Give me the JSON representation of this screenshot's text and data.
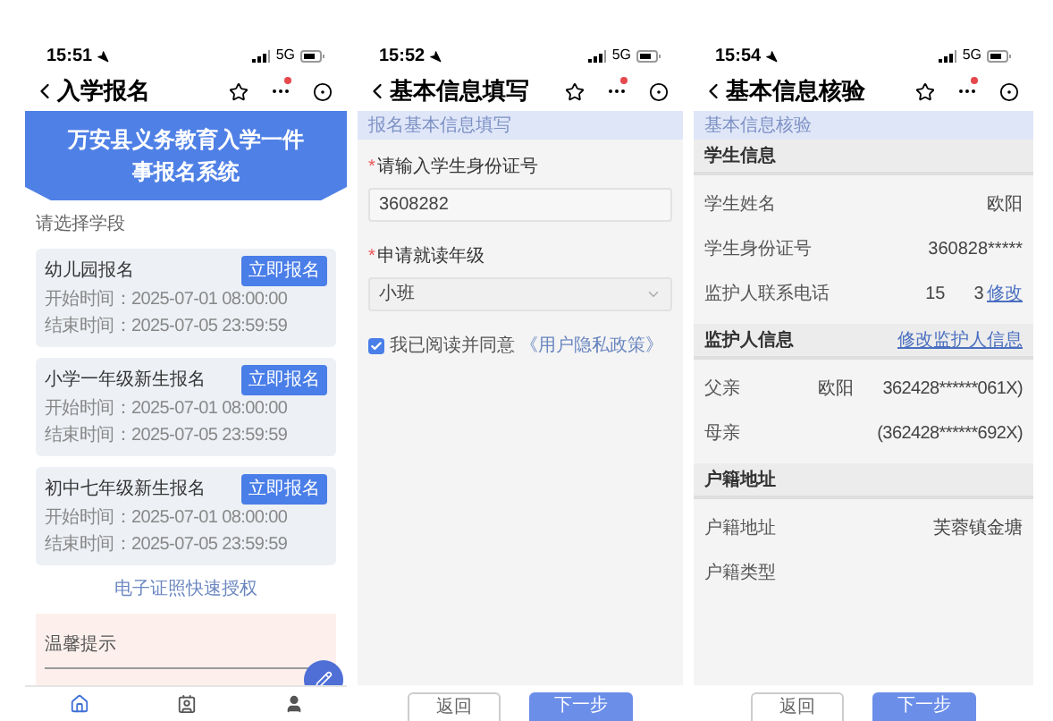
{
  "phones": [
    {
      "kind": "enroll",
      "status": {
        "time": "15:51",
        "network": "5G"
      },
      "nav": {
        "title": "入学报名",
        "notify": true
      },
      "banner": {
        "title": "万安县义务教育入学一件事报名系统"
      },
      "section_label": "请选择学段",
      "cards": [
        {
          "title": "幼儿园报名",
          "start": "开始时间：2025-07-01 08:00:00",
          "end": "结束时间：2025-07-05 23:59:59",
          "button": "立即报名"
        },
        {
          "title": "小学一年级新生报名",
          "start": "开始时间：2025-07-01 08:00:00",
          "end": "结束时间：2025-07-05 23:59:59",
          "button": "立即报名"
        },
        {
          "title": "初中七年级新生报名",
          "start": "开始时间：2025-07-01 08:00:00",
          "end": "结束时间：2025-07-05 23:59:59",
          "button": "立即报名"
        }
      ],
      "link": "电子证照快速授权",
      "tip": {
        "title": "温馨提示"
      },
      "tabbar": [
        {
          "selected": true
        },
        {
          "selected": false
        },
        {
          "selected": false
        }
      ]
    },
    {
      "kind": "form",
      "status": {
        "time": "15:52",
        "network": "5G"
      },
      "nav": {
        "title": "基本信息填写",
        "notify": true
      },
      "section": "报名基本信息填写",
      "fields": [
        {
          "kind": "input",
          "mark": "*",
          "label": "请输入学生身份证号",
          "value": "3608282"
        },
        {
          "kind": "select",
          "mark": "*",
          "label": "申请就读年级",
          "value": "小班"
        }
      ],
      "agreement": {
        "checked": true,
        "text": "我已阅读并同意",
        "link": "《用户隐私政策》"
      },
      "buttons": [
        {
          "kind": "secondary",
          "label": "返回"
        },
        {
          "kind": "primary",
          "label": "下一步"
        }
      ]
    },
    {
      "kind": "review",
      "status": {
        "time": "15:54",
        "network": "5G"
      },
      "nav": {
        "title": "基本信息核验",
        "notify": true
      },
      "section": "基本信息核验",
      "groups": [
        {
          "title": "学生信息",
          "rows": [
            {
              "label": "学生姓名",
              "value": "欧阳"
            },
            {
              "label": "学生身份证号",
              "value": "360828*****"
            },
            {
              "label": "监护人联系电话",
              "value": "15",
              "value_2": "3",
              "action": "修改"
            }
          ]
        },
        {
          "title": "监护人信息",
          "action": "修改监护人信息",
          "rows": [
            {
              "label": "父亲",
              "value": "欧阳",
              "value_2": "362428******061X)"
            },
            {
              "label": "母亲",
              "value_2": "(362428******692X)"
            }
          ]
        },
        {
          "title": "户籍地址",
          "rows": [
            {
              "label": "户籍地址",
              "value": "芙蓉镇金塘"
            },
            {
              "label": "户籍类型"
            }
          ]
        }
      ],
      "buttons": [
        {
          "kind": "secondary",
          "label": "返回"
        },
        {
          "kind": "primary",
          "label": "下一步"
        }
      ]
    }
  ]
}
